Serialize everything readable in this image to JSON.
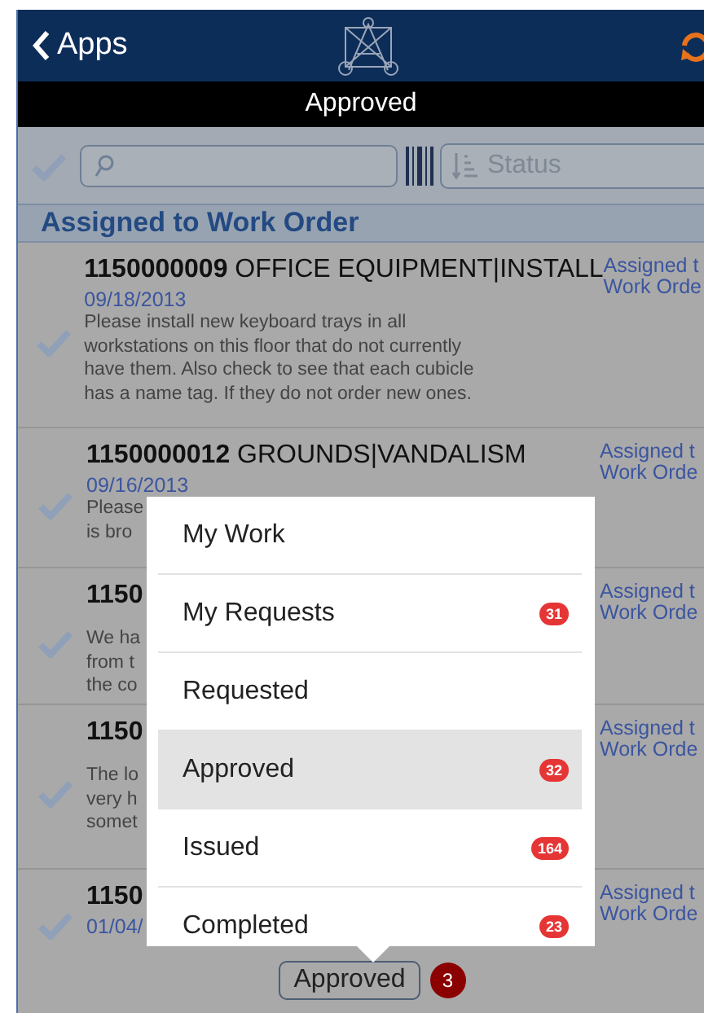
{
  "header": {
    "back_label": "Apps"
  },
  "title_bar": {
    "title": "Approved"
  },
  "toolbar": {
    "sort": {
      "placeholder": "Status"
    }
  },
  "section": {
    "title": "Assigned to Work Order"
  },
  "items": [
    {
      "number": "1150000009",
      "name": "OFFICE EQUIPMENT|INSTALL",
      "date": "09/18/2013",
      "description": "Please install new keyboard trays in all\nworkstations on this floor that do not currently\nhave them. Also check to see that each cubicle\nhas a name tag. If they do not order new ones.",
      "status": [
        "Assigned t",
        "Work Orde"
      ]
    },
    {
      "number": "1150000012",
      "name": "GROUNDS|VANDALISM",
      "date": "09/16/2013",
      "description": "Please\nis bro",
      "status": [
        "Assigned t",
        "Work Orde"
      ]
    },
    {
      "number": "1150",
      "description": "We ha\nfrom t\nthe co",
      "status": [
        "Assigned t",
        "Work Orde"
      ]
    },
    {
      "number": "1150",
      "description": "The lo\nvery h\nsomet",
      "status": [
        "Assigned t",
        "Work Orde"
      ]
    },
    {
      "number": "1150",
      "date": "01/04/",
      "status": [
        "Assigned t",
        "Work Orde"
      ]
    }
  ],
  "menu": {
    "items": [
      {
        "label": "My Work",
        "selected": false
      },
      {
        "label": "My Requests",
        "badge": "31",
        "selected": false
      },
      {
        "label": "Requested",
        "selected": false
      },
      {
        "label": "Approved",
        "badge": "32",
        "selected": true
      },
      {
        "label": "Issued",
        "badge": "164",
        "selected": false
      },
      {
        "label": "Completed",
        "badge": "23",
        "selected": false
      }
    ]
  },
  "footer": {
    "filter_label": "Approved",
    "count": "3"
  }
}
